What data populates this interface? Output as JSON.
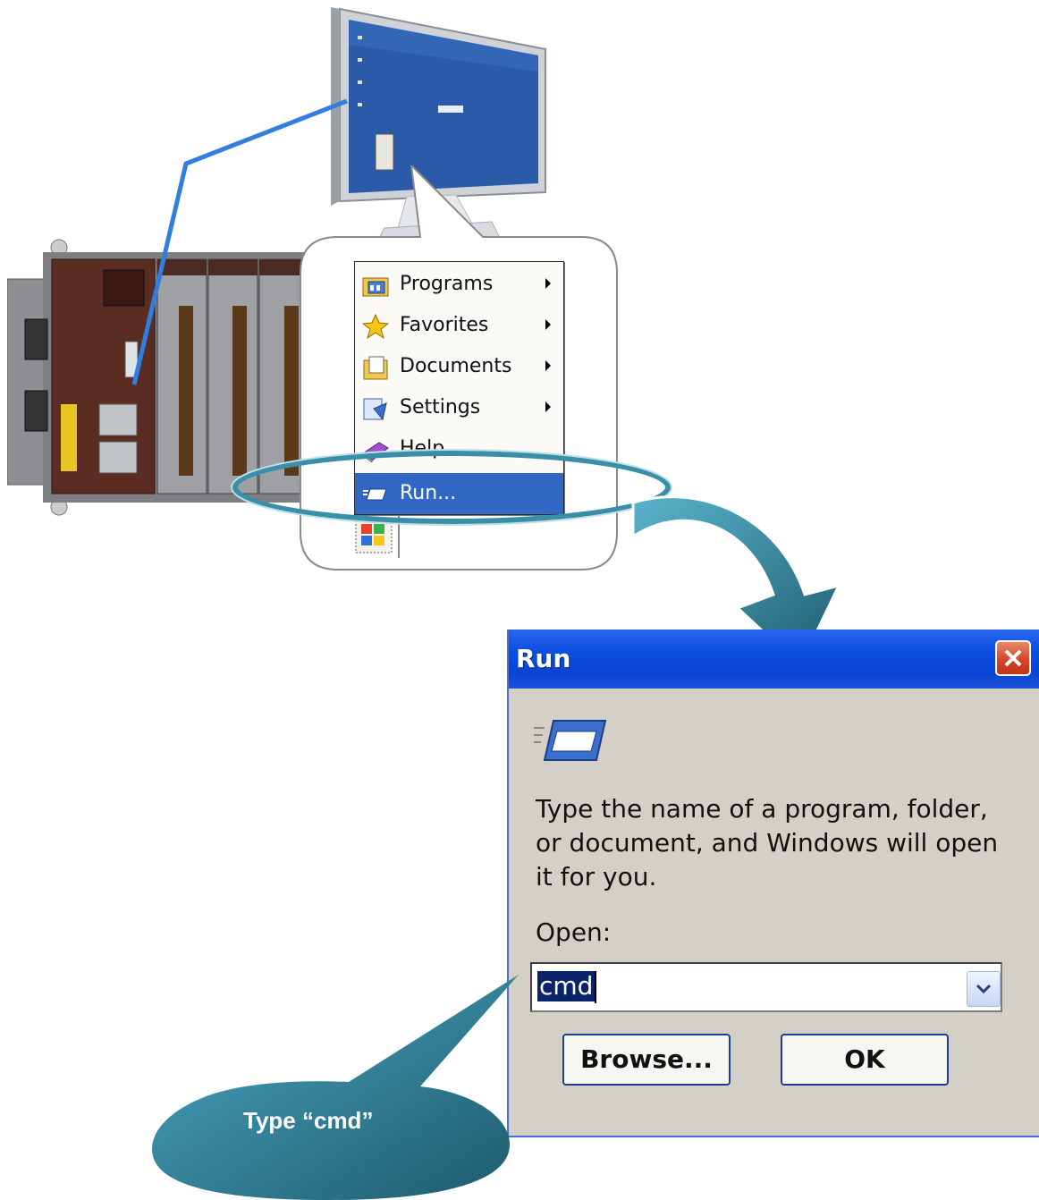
{
  "start_menu": {
    "items": [
      {
        "label": "Programs",
        "icon": "programs-icon",
        "has_submenu": true
      },
      {
        "label": "Favorites",
        "icon": "star-icon",
        "has_submenu": true
      },
      {
        "label": "Documents",
        "icon": "documents-icon",
        "has_submenu": true
      },
      {
        "label": "Settings",
        "icon": "settings-icon",
        "has_submenu": true
      },
      {
        "label": "Help",
        "icon": "help-book-icon",
        "has_submenu": false
      },
      {
        "label": "Run...",
        "icon": "run-icon",
        "has_submenu": false,
        "selected": true
      }
    ]
  },
  "run_dialog": {
    "title": "Run",
    "description": "Type the name of a program, folder, or document, and Windows will open it for you.",
    "open_label": "Open:",
    "open_value": "cmd",
    "browse_label": "Browse...",
    "ok_label": "OK"
  },
  "callout": {
    "text": "Type “cmd”"
  },
  "colors": {
    "selection": "#3168c5",
    "titlebar": "#0a44d2",
    "accent_teal": "#3a8fa8",
    "cable": "#2f7fe0"
  }
}
